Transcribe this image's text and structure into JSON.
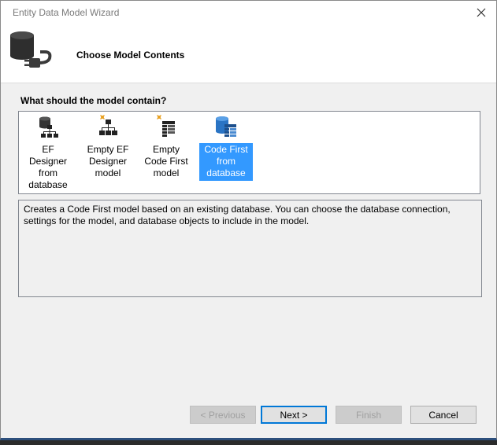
{
  "window": {
    "title": "Entity Data Model Wizard",
    "close_glyph": "✕"
  },
  "header": {
    "icon": "database-plug-icon",
    "title": "Choose Model Contents"
  },
  "question": "What should the model contain?",
  "model_options": [
    {
      "label": "EF Designer from database",
      "icon": "database-designer-icon",
      "selected": false
    },
    {
      "label": "Empty EF Designer model",
      "icon": "empty-designer-icon",
      "selected": false
    },
    {
      "label": "Empty Code First model",
      "icon": "empty-code-first-icon",
      "selected": false
    },
    {
      "label": "Code First from database",
      "icon": "code-first-database-icon",
      "selected": true
    }
  ],
  "description": "Creates a Code First model based on an existing database. You can choose the database connection, settings for the model, and database objects to include in the model.",
  "buttons": {
    "previous": "< Previous",
    "next": "Next >",
    "finish": "Finish",
    "cancel": "Cancel"
  },
  "colors": {
    "selection": "#3399ff",
    "accent": "#0078d7"
  }
}
